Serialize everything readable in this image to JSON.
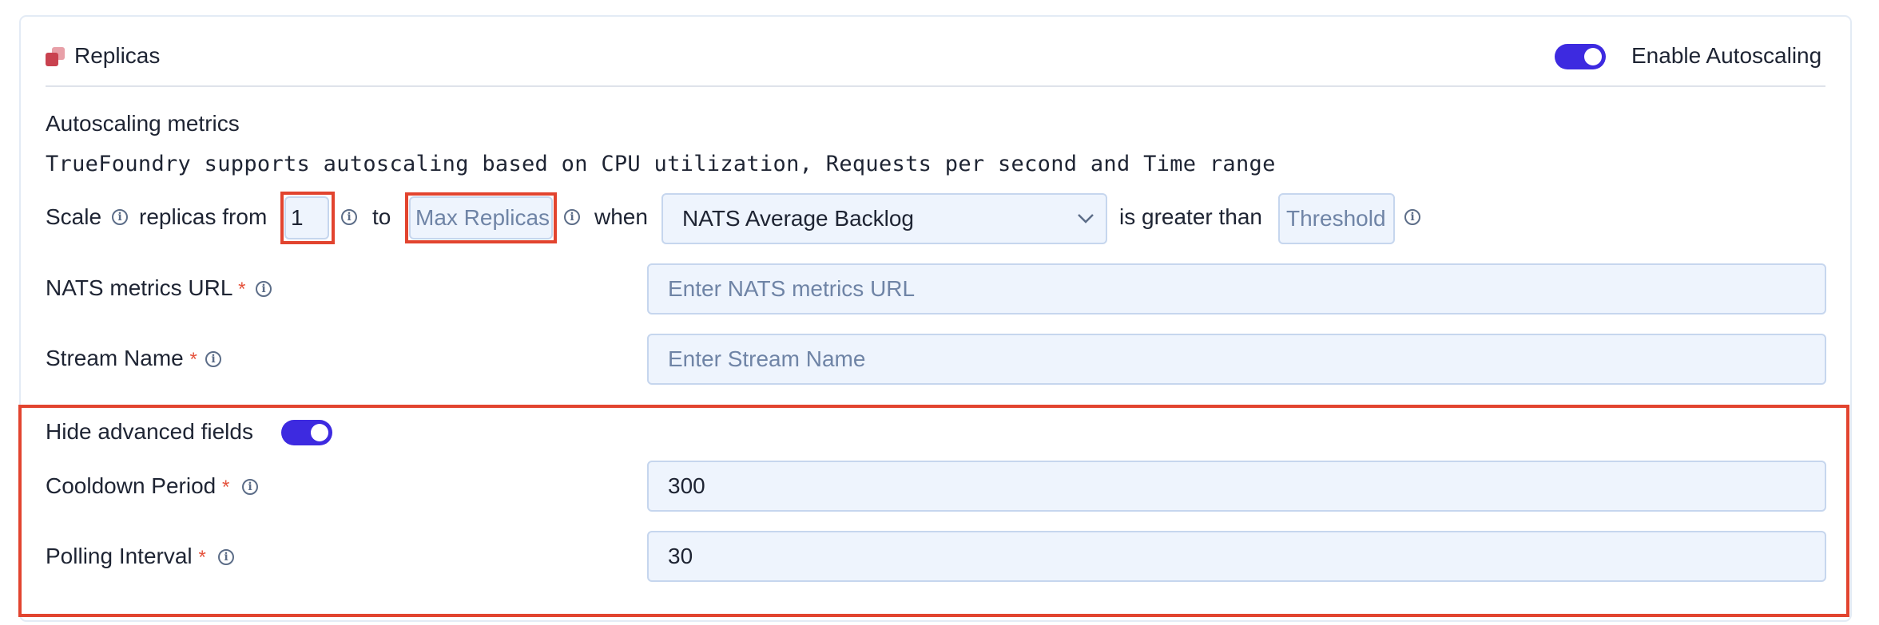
{
  "header": {
    "title": "Replicas",
    "autoscaling_label": "Enable Autoscaling"
  },
  "metrics": {
    "title": "Autoscaling metrics",
    "description": "TrueFoundry supports autoscaling based on CPU utilization, Requests per second and Time range"
  },
  "scale_row": {
    "scale_label": "Scale",
    "replicas_from_label": "replicas from",
    "min_value": "1",
    "to_label": "to",
    "max_placeholder": "Max Replicas",
    "when_label": "when",
    "metric_selected": "NATS Average Backlog",
    "greater_label": "is greater than",
    "threshold_placeholder": "Threshold"
  },
  "fields": {
    "nats_url": {
      "label": "NATS metrics URL",
      "required": "*",
      "placeholder": "Enter NATS metrics URL"
    },
    "stream_name": {
      "label": "Stream Name",
      "required": "*",
      "placeholder": "Enter Stream Name"
    }
  },
  "advanced": {
    "toggle_label": "Hide advanced fields",
    "cooldown": {
      "label": "Cooldown Period",
      "required": "*",
      "value": "300"
    },
    "polling": {
      "label": "Polling Interval",
      "required": "*",
      "value": "30"
    }
  },
  "colors": {
    "accent": "#3d2ae0",
    "highlight": "#e2442f",
    "required": "#e5533d",
    "input_bg": "#eef4fd"
  }
}
